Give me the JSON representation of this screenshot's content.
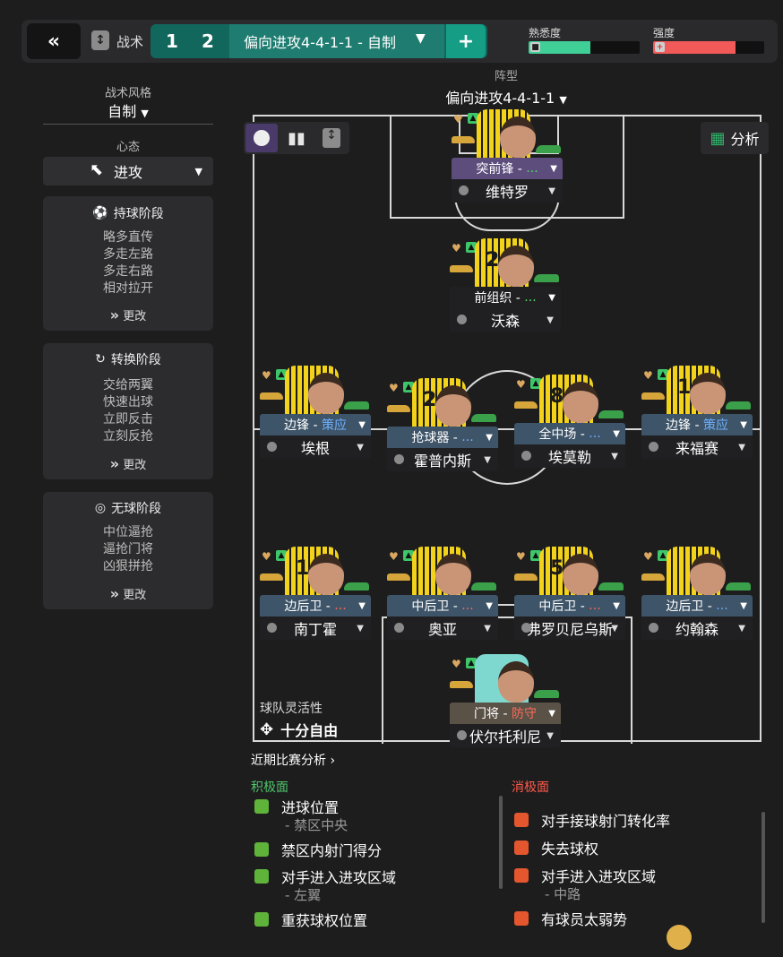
{
  "header": {
    "back_icon": "«",
    "tactic_label": "战术",
    "slot1": "1",
    "slot2": "2",
    "tactic_name": "偏向进攻4-4-1-1 - 自制",
    "add_icon": "+",
    "familiarity_label": "熟悉度",
    "familiarity_level": 0.56,
    "familiarity_color": "#3fcf97",
    "intensity_label": "强度",
    "intensity_level": 0.74,
    "intensity_color": "#f25a5a"
  },
  "left_panel": {
    "style_title": "战术风格",
    "style_value": "自制",
    "mentality_title": "心态",
    "mentality_value": "进攻",
    "in_possession": {
      "title": "持球阶段",
      "lines": [
        "略多直传",
        "多走左路",
        "多走右路",
        "相对拉开"
      ],
      "change": "更改"
    },
    "transition": {
      "title": "转换阶段",
      "lines": [
        "交给两翼",
        "快速出球",
        "立即反击",
        "立刻反抢"
      ],
      "change": "更改"
    },
    "out_possession": {
      "title": "无球阶段",
      "lines": [
        "中位逼抢",
        "逼抢门将",
        "凶狠拼抢"
      ],
      "change": "更改"
    }
  },
  "pitch": {
    "formation_label": "阵型",
    "formation_value": "偏向进攻4-4-1-1",
    "analysis_label": "分析",
    "flex_title": "球队灵活性",
    "flex_value": "十分自由",
    "players": [
      {
        "id": "st",
        "num": "",
        "role": "突前锋 -",
        "duty": "...",
        "duty_class": "duty-green",
        "name": "维特罗",
        "role_bg": "#5c4d7d"
      },
      {
        "id": "am",
        "num": "2",
        "role": "前组织 -",
        "duty": "...",
        "duty_class": "duty-green",
        "name": "沃森",
        "role_bg": "#202022"
      },
      {
        "id": "lm",
        "num": "",
        "role": "边锋 -",
        "duty": "策应",
        "duty_class": "duty-blue",
        "name": "埃根",
        "role_bg": "#3e5468"
      },
      {
        "id": "cm1",
        "num": "2",
        "role": "抢球器 -",
        "duty": "...",
        "duty_class": "duty-blue",
        "name": "霍普内斯",
        "role_bg": "#3e5468"
      },
      {
        "id": "cm2",
        "num": "8",
        "role": "全中场 -",
        "duty": "...",
        "duty_class": "duty-blue",
        "name": "埃莫勒",
        "role_bg": "#3e5468"
      },
      {
        "id": "rm",
        "num": "10",
        "role": "边锋 -",
        "duty": "策应",
        "duty_class": "duty-blue",
        "name": "来福赛",
        "role_bg": "#3e5468"
      },
      {
        "id": "lb",
        "num": "1",
        "role": "边后卫 -",
        "duty": "...",
        "duty_class": "duty-red",
        "name": "南丁霍",
        "role_bg": "#3e5468"
      },
      {
        "id": "cb1",
        "num": "",
        "role": "中后卫 -",
        "duty": "...",
        "duty_class": "duty-red",
        "name": "奥亚",
        "role_bg": "#3e5468"
      },
      {
        "id": "cb2",
        "num": "5",
        "role": "中后卫 -",
        "duty": "...",
        "duty_class": "duty-red",
        "name": "弗罗贝尼乌斯",
        "role_bg": "#3e5468"
      },
      {
        "id": "rb",
        "num": "",
        "role": "边后卫 -",
        "duty": "...",
        "duty_class": "duty-blue",
        "name": "约翰森",
        "role_bg": "#3e5468"
      },
      {
        "id": "gk",
        "num": "",
        "role": "门将 -",
        "duty": "防守",
        "duty_class": "duty-red",
        "name": "伏尔托利尼",
        "role_bg": "#5a5247"
      }
    ]
  },
  "analysis": {
    "title": "近期比赛分析",
    "positive_title": "积极面",
    "negative_title": "消极面",
    "positive": [
      {
        "label": "进球位置",
        "sub": "- 禁区中央"
      },
      {
        "label": "禁区内射门得分",
        "sub": ""
      },
      {
        "label": "对手进入进攻区域",
        "sub": "- 左翼"
      },
      {
        "label": "重获球权位置",
        "sub": ""
      }
    ],
    "negative": [
      {
        "label": "对手接球射门转化率",
        "sub": ""
      },
      {
        "label": "失去球权",
        "sub": ""
      },
      {
        "label": "对手进入进攻区域",
        "sub": "- 中路"
      },
      {
        "label": "有球员太弱势",
        "sub": ""
      }
    ]
  }
}
